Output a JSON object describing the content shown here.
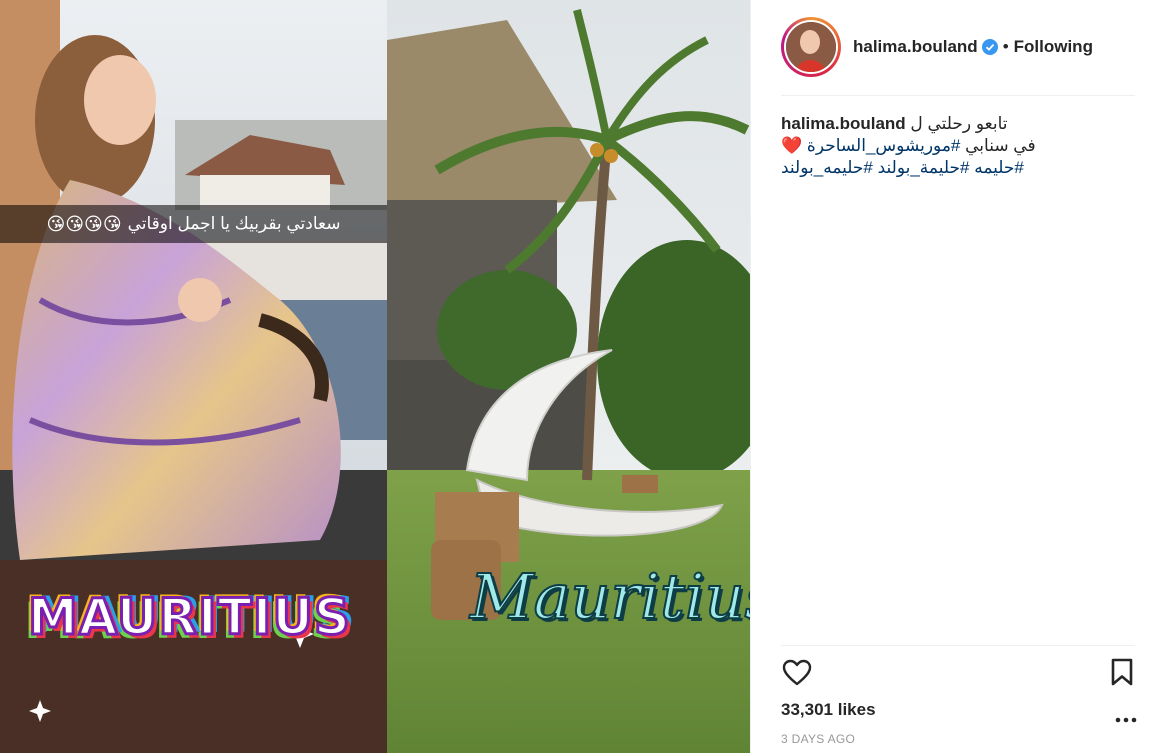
{
  "media": {
    "snap_caption_text": "سعادتي بقربيك يا اجمل اوقاتي",
    "snap_caption_emoji": "😘😘😘😘",
    "sticker_left": "MAURITIUS",
    "sticker_right": "Mauritius"
  },
  "header": {
    "username": "halima.bouland",
    "separator": "•",
    "follow_state": "Following"
  },
  "caption": {
    "username": "halima.bouland",
    "line1_text": "تابعو رحلتي ل",
    "line2_heart": "❤️",
    "line2_hashtag": "#موريشوس_الساحرة",
    "line2_text": " في سنابي",
    "line3_hashtag1": "#حليمه_بولند",
    "line3_hashtag2": "#حليمة_بولند",
    "line3_hashtag3": "#حليمه"
  },
  "footer": {
    "likes": "33,301 likes",
    "time": "3 DAYS AGO"
  },
  "icons": {
    "like": "heart-outline-icon",
    "save": "bookmark-icon",
    "more": "more-horizontal-icon",
    "verified": "verified-badge-icon"
  },
  "colors": {
    "verified_blue": "#3897f0",
    "hashtag": "#003569",
    "muted": "#999999"
  }
}
